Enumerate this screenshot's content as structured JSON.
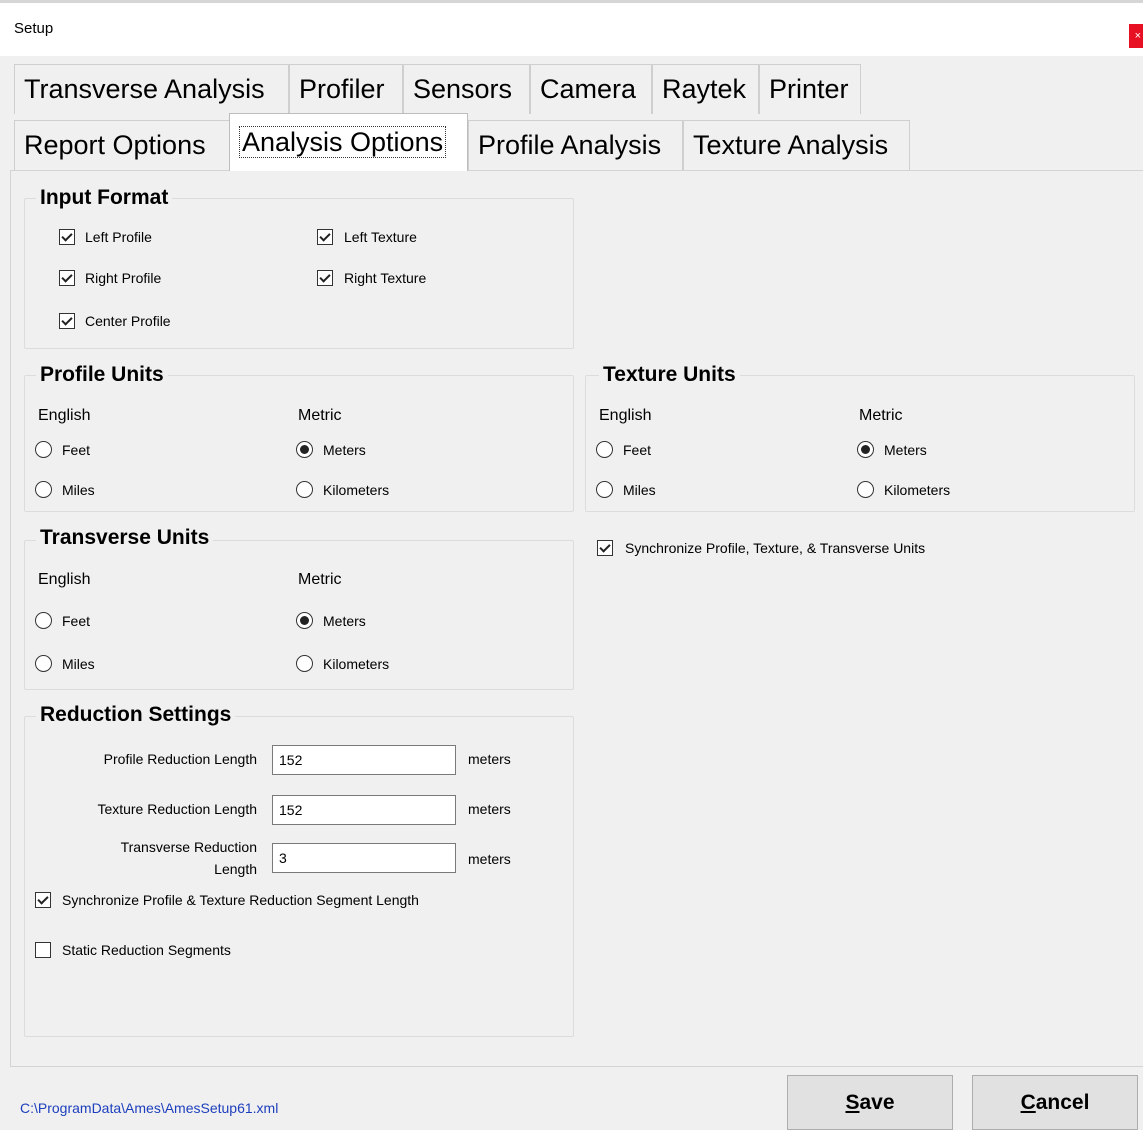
{
  "window": {
    "title": "Setup",
    "close_glyph": "×"
  },
  "tabs_row1": [
    {
      "label": "Transverse Analysis"
    },
    {
      "label": "Profiler"
    },
    {
      "label": "Sensors"
    },
    {
      "label": "Camera"
    },
    {
      "label": "Raytek"
    },
    {
      "label": "Printer"
    }
  ],
  "tabs_row2": [
    {
      "label": "Report Options"
    },
    {
      "label": "Analysis Options",
      "active": true
    },
    {
      "label": "Profile Analysis"
    },
    {
      "label": "Texture Analysis"
    }
  ],
  "input_format": {
    "title": "Input Format",
    "items": [
      {
        "label": "Left Profile",
        "checked": true
      },
      {
        "label": "Right Profile",
        "checked": true
      },
      {
        "label": "Center Profile",
        "checked": true
      },
      {
        "label": "Left Texture",
        "checked": true
      },
      {
        "label": "Right Texture",
        "checked": true
      }
    ]
  },
  "profile_units": {
    "title": "Profile Units",
    "english_label": "English",
    "metric_label": "Metric",
    "feet": "Feet",
    "miles": "Miles",
    "meters": "Meters",
    "kilometers": "Kilometers",
    "selected": "Meters"
  },
  "texture_units": {
    "title": "Texture Units",
    "english_label": "English",
    "metric_label": "Metric",
    "feet": "Feet",
    "miles": "Miles",
    "meters": "Meters",
    "kilometers": "Kilometers",
    "selected": "Meters"
  },
  "transverse_units": {
    "title": "Transverse Units",
    "english_label": "English",
    "metric_label": "Metric",
    "feet": "Feet",
    "miles": "Miles",
    "meters": "Meters",
    "kilometers": "Kilometers",
    "selected": "Meters"
  },
  "sync_units": {
    "label": "Synchronize Profile, Texture, & Transverse Units",
    "checked": true
  },
  "reduction": {
    "title": "Reduction Settings",
    "profile_label": "Profile Reduction Length",
    "profile_value": "152",
    "profile_unit": "meters",
    "texture_label": "Texture Reduction Length",
    "texture_value": "152",
    "texture_unit": "meters",
    "transverse_label_1": "Transverse Reduction",
    "transverse_label_2": "Length",
    "transverse_value": "3",
    "transverse_unit": "meters",
    "sync_label": "Synchronize Profile & Texture Reduction Segment Length",
    "sync_checked": true,
    "static_label": "Static Reduction Segments",
    "static_checked": false
  },
  "footer": {
    "path": "C:\\ProgramData\\Ames\\AmesSetup61.xml",
    "save_mnemonic": "S",
    "save_rest": "ave",
    "cancel_mnemonic": "C",
    "cancel_rest": "ancel"
  }
}
